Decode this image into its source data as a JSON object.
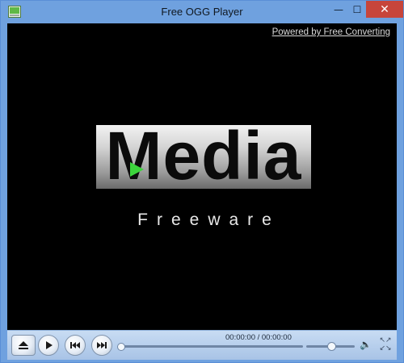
{
  "window": {
    "title": "Free OGG Player",
    "minimize_glyph": "—",
    "maximize_glyph": "☐",
    "close_glyph": "✕"
  },
  "video": {
    "powered_link": "Powered by Free Converting",
    "logo_main": "Media",
    "logo_sub": "Freeware"
  },
  "controls": {
    "time_display": "00:00:00 / 00:00:00",
    "seek_progress": 0,
    "volume_level": 0.5,
    "icons": [
      "eject-icon",
      "play-icon",
      "previous-icon",
      "next-icon",
      "speaker-icon",
      "fullscreen-icon"
    ]
  },
  "colors": {
    "titlebar": "#6fa1df",
    "close_button": "#c7453b",
    "video_background": "#000000",
    "logo_play_green": "#3cd43c",
    "controls_bar": "#b8d0ee"
  }
}
